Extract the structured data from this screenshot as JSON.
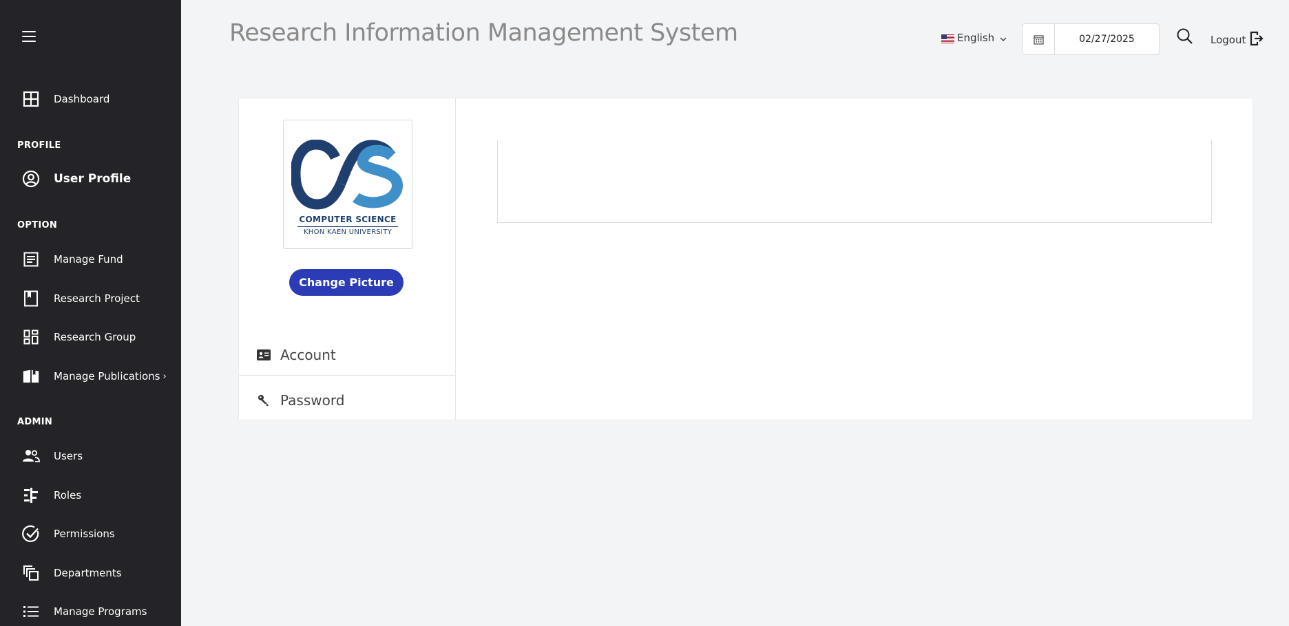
{
  "app": {
    "title": "Research Information Management System"
  },
  "header": {
    "language": "English",
    "date": "02/27/2025",
    "logout_label": "Logout"
  },
  "sidebar": {
    "dashboard": "Dashboard",
    "sections": {
      "profile": "PROFILE",
      "option": "OPTION",
      "admin": "ADMIN"
    },
    "items": {
      "user_profile": "User Profile",
      "manage_fund": "Manage Fund",
      "research_project": "Research Project",
      "research_group": "Research Group",
      "manage_publications": "Manage Publications",
      "users": "Users",
      "roles": "Roles",
      "permissions": "Permissions",
      "departments": "Departments",
      "manage_programs": "Manage Programs"
    }
  },
  "profile": {
    "logo": {
      "line1": "COMPUTER SCIENCE",
      "line2": "KHON KAEN UNIVERSITY"
    },
    "change_picture": "Change Picture",
    "tabs": {
      "account": "Account",
      "password": "Password"
    }
  },
  "colors": {
    "sidebar_bg": "#242428",
    "page_bg": "#f3f4f6",
    "button_blue": "#2b3cb6",
    "logo_dark": "#1f3f6e",
    "logo_light": "#3f8fc8"
  }
}
